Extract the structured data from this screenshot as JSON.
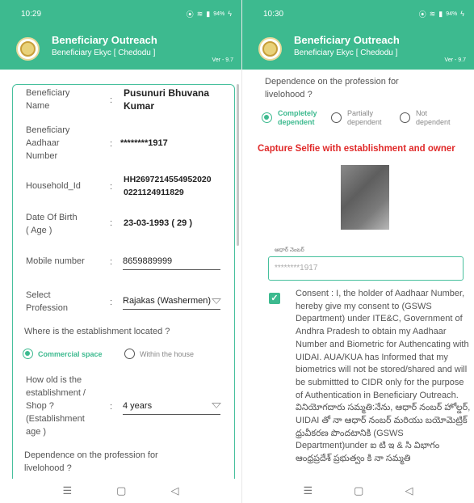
{
  "colors": {
    "brand": "#3dba8f",
    "card_border": "#47c09d",
    "alert": "#e02a2a",
    "selfie_fill": "#6e6e6e"
  },
  "app": {
    "title": "Beneficiary Outreach",
    "subtitle": "Beneficiary Ekyc [ Chedodu ]",
    "version": "Ver - 9.7"
  },
  "left": {
    "time": "10:29",
    "battery": "94%",
    "fields": {
      "name_label": "Beneficiary\nName",
      "name_value": "Pusunuri Bhuvana\nKumar",
      "aadhaar_label": "Beneficiary\nAadhaar\nNumber",
      "aadhaar_value": "********1917",
      "household_label": "Household_Id",
      "household_value": "HH2697214554952020\n0221124911829",
      "dob_label": "Date Of Birth\n( Age )",
      "dob_value": "23-03-1993 ( 29 )",
      "mobile_label": "Mobile number",
      "mobile_value": "8659889999",
      "profession_label": "Select\nProfession",
      "profession_value": "Rajakas (Washermen)",
      "location_question": "Where is the establishment located ?",
      "location_options": [
        "Commercial space",
        "Within the house"
      ],
      "age_label": "How old is the\nestablishment /\nShop ?\n(Establishment\nage )",
      "age_value": "4 years",
      "dependence_question": "Dependence on the profession for\nlivelohood ?"
    },
    "colon": ":"
  },
  "right": {
    "time": "10:30",
    "battery": "94%",
    "dependence_question": "Dependence on the profession for\nlivelohood ?",
    "dependence_options": [
      "Completely\ndependent",
      "Partially\ndependent",
      "Not\ndependent"
    ],
    "capture_heading": "Capture Selfie with establishment and owner",
    "aadhar_caption": "ఆధార్ నెంబర్",
    "aadhar_value": "********1917",
    "consent_text": "Consent : I, the holder of Aadhaar Number, hereby give my consent to (GSWS Department) under ITE&C, Government of Andhra Pradesh to obtain my Aadhaar Number and Biometric for Authencating with UIDAI. AUA/KUA has Informed that my biometrics will not be stored/shared and will be submittted to CIDR only for the purpose of Authentication in Beneficiary Outreach.\nవినియోగదారు సమ్మతి:నేను, ఆధార్ నంబర్ హోల్డర్, UIDAI తో నా ఆధార్ నంబర్ మరియు బయోమెట్రిక్ ధ్రువీకరణ పొందటానికి (GSWS Department)under ఐ టి ఇ & సి విభాగం ఆంధ్రప్రదేశ్ ప్రభుత్వం కి నా సమ్మతి"
  },
  "nav": {
    "recent": "☰",
    "home": "▢",
    "back": "◁"
  }
}
